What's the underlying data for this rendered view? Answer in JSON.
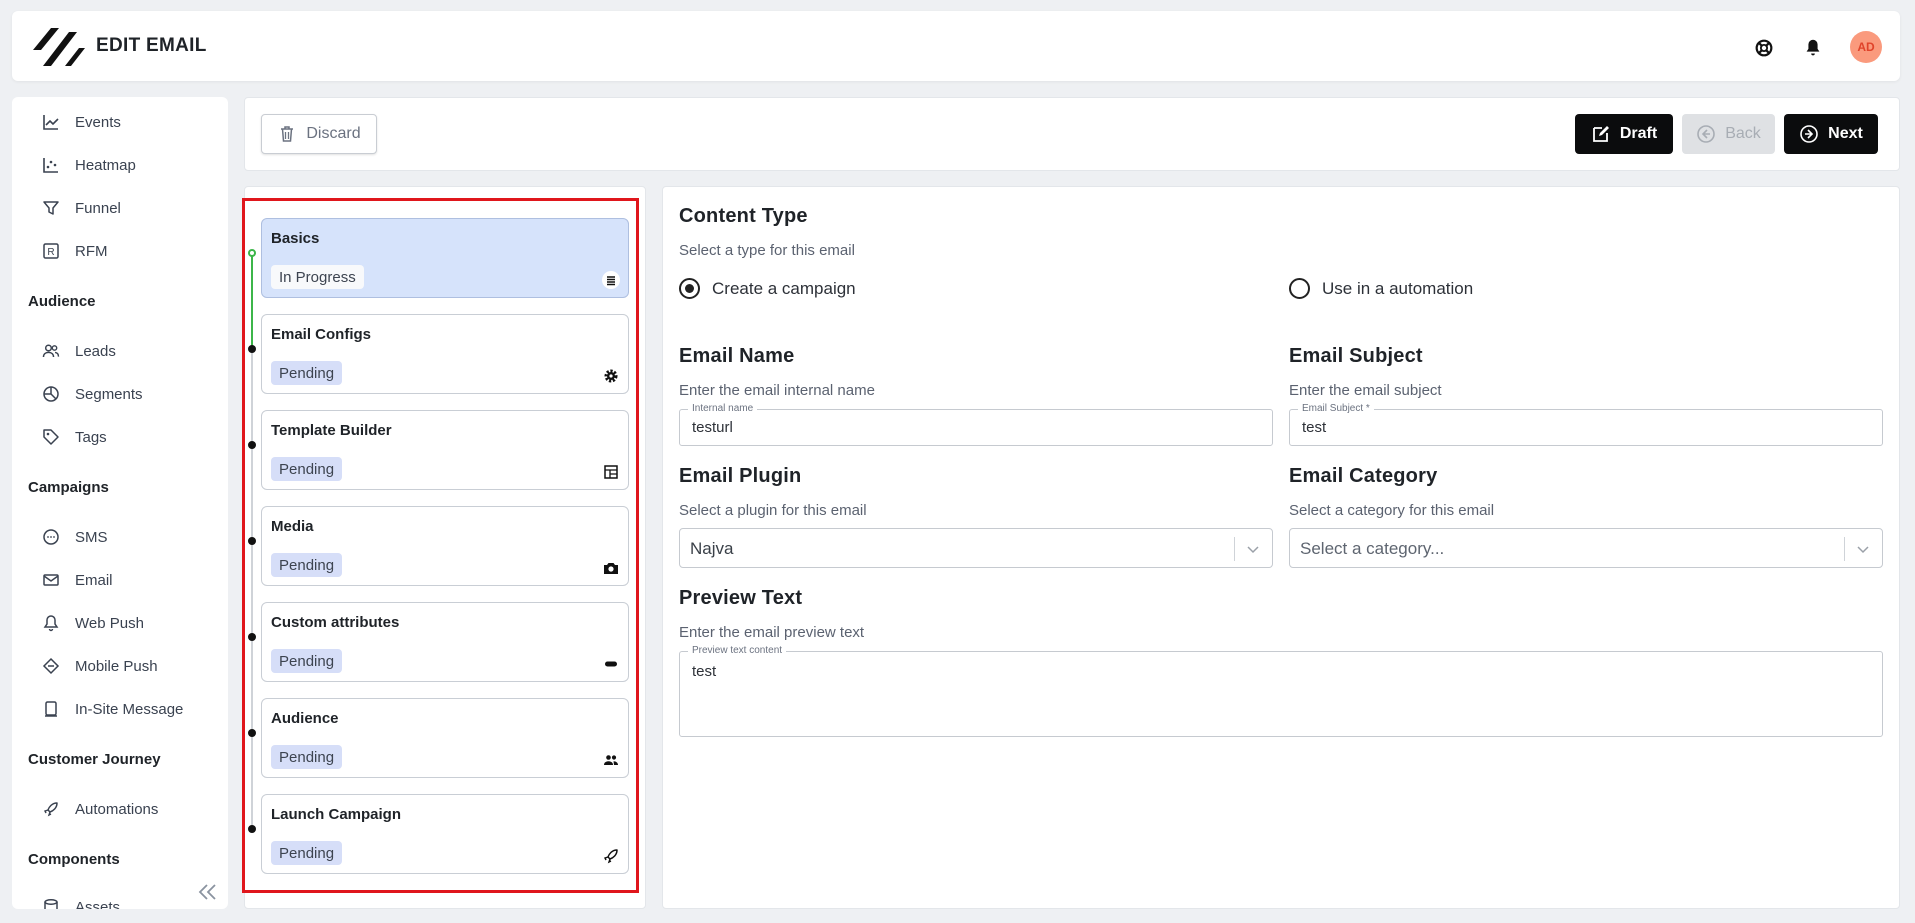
{
  "header": {
    "title": "EDIT EMAIL",
    "avatar_initials": "AD",
    "icons": [
      "support-icon",
      "bell-icon"
    ]
  },
  "sidebar": {
    "items_top": [
      {
        "label": "Events",
        "icon": "chart-line-icon"
      },
      {
        "label": "Heatmap",
        "icon": "scatter-icon"
      },
      {
        "label": "Funnel",
        "icon": "funnel-icon"
      },
      {
        "label": "RFM",
        "icon": "rfm-icon"
      }
    ],
    "sections": [
      {
        "title": "Audience",
        "items": [
          {
            "label": "Leads",
            "icon": "users-icon"
          },
          {
            "label": "Segments",
            "icon": "pie-chart-icon"
          },
          {
            "label": "Tags",
            "icon": "tag-icon"
          }
        ]
      },
      {
        "title": "Campaigns",
        "items": [
          {
            "label": "SMS",
            "icon": "chat-icon"
          },
          {
            "label": "Email",
            "icon": "mail-icon"
          },
          {
            "label": "Web Push",
            "icon": "bell-outline-icon"
          },
          {
            "label": "Mobile Push",
            "icon": "mobile-push-icon"
          },
          {
            "label": "In-Site Message",
            "icon": "in-site-icon"
          }
        ]
      },
      {
        "title": "Customer Journey",
        "items": [
          {
            "label": "Automations",
            "icon": "rocket-icon"
          }
        ]
      },
      {
        "title": "Components",
        "items": [
          {
            "label": "Assets",
            "icon": "database-icon"
          }
        ]
      }
    ]
  },
  "toolbar": {
    "discard_label": "Discard",
    "draft_label": "Draft",
    "back_label": "Back",
    "next_label": "Next"
  },
  "steps": [
    {
      "title": "Basics",
      "status": "In Progress",
      "icon": "list-icon",
      "active": true
    },
    {
      "title": "Email Configs",
      "status": "Pending",
      "icon": "gear-icon"
    },
    {
      "title": "Template Builder",
      "status": "Pending",
      "icon": "template-icon"
    },
    {
      "title": "Media",
      "status": "Pending",
      "icon": "camera-icon"
    },
    {
      "title": "Custom attributes",
      "status": "Pending",
      "icon": "toggle-icon"
    },
    {
      "title": "Audience",
      "status": "Pending",
      "icon": "people-icon"
    },
    {
      "title": "Launch Campaign",
      "status": "Pending",
      "icon": "rocket-icon"
    }
  ],
  "form": {
    "content_type": {
      "title": "Content Type",
      "desc": "Select a type for this email",
      "options": [
        {
          "label": "Create a campaign",
          "selected": true
        },
        {
          "label": "Use in a automation",
          "selected": false
        }
      ]
    },
    "email_name": {
      "title": "Email Name",
      "desc": "Enter the email internal name",
      "field_label": "Internal name",
      "value": "testurl"
    },
    "email_subject": {
      "title": "Email Subject",
      "desc": "Enter the email subject",
      "field_label": "Email Subject *",
      "value": "test"
    },
    "email_plugin": {
      "title": "Email Plugin",
      "desc": "Select a plugin for this email",
      "value": "Najva"
    },
    "email_category": {
      "title": "Email Category",
      "desc": "Select a category for this email",
      "placeholder": "Select a category..."
    },
    "preview_text": {
      "title": "Preview Text",
      "desc": "Enter the email preview text",
      "field_label": "Preview text content",
      "value": "test"
    }
  }
}
